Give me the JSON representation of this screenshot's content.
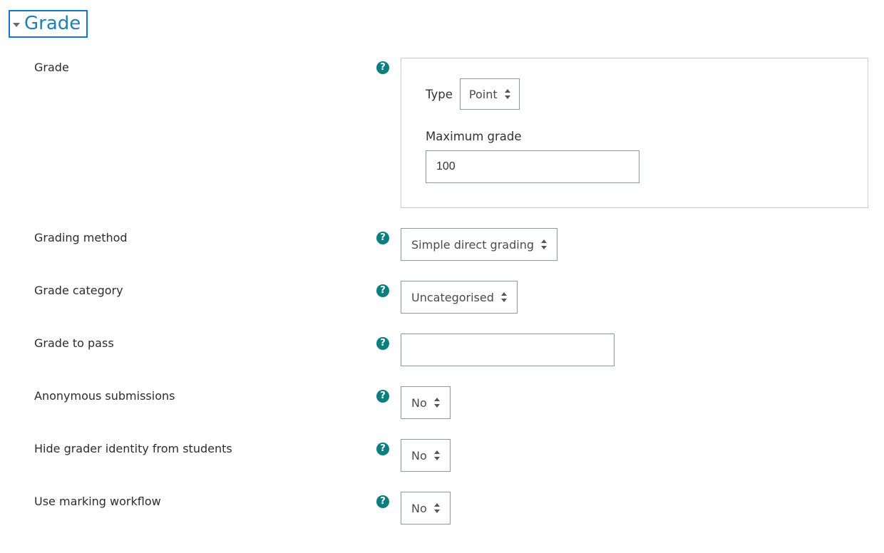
{
  "section": {
    "title": "Grade"
  },
  "fields": {
    "grade": {
      "label": "Grade",
      "type_label": "Type",
      "type_value": "Point",
      "max_label": "Maximum grade",
      "max_value": "100"
    },
    "grading_method": {
      "label": "Grading method",
      "value": "Simple direct grading"
    },
    "grade_category": {
      "label": "Grade category",
      "value": "Uncategorised"
    },
    "grade_to_pass": {
      "label": "Grade to pass",
      "value": ""
    },
    "anonymous": {
      "label": "Anonymous submissions",
      "value": "No"
    },
    "hide_grader": {
      "label": "Hide grader identity from students",
      "value": "No"
    },
    "marking_workflow": {
      "label": "Use marking workflow",
      "value": "No"
    }
  },
  "help_glyph": "?"
}
